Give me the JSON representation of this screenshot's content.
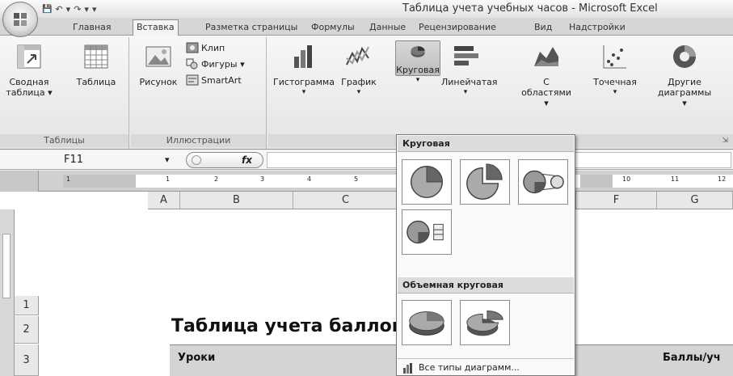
{
  "window": {
    "title": "Таблица учета учебных часов - Microsoft Excel"
  },
  "quick_access": {
    "save": "💾",
    "undo": "↶",
    "redo": "↷",
    "more": "▾"
  },
  "tabs": [
    "Главная",
    "Вставка",
    "Разметка страницы",
    "Формулы",
    "Данные",
    "Рецензирование",
    "Вид",
    "Надстройки"
  ],
  "ribbon": {
    "groups": {
      "tables": "Таблицы",
      "illustrations": "Иллюстрации",
      "charts_corner": "⇲"
    },
    "buttons": {
      "pivot": "Сводная таблица ▾",
      "table": "Таблица",
      "picture": "Рисунок",
      "clip": "Клип",
      "shapes": "Фигуры ▾",
      "smartart": "SmartArt",
      "histogram": "Гистограмма",
      "histogram_arrow": "▾",
      "graph": "График",
      "graph_arrow": "▾",
      "pie": "Круговая",
      "pie_arrow": "▾",
      "bar": "Линейчатая",
      "bar_arrow": "▾",
      "area": "С областями ▾",
      "scatter": "Точечная",
      "scatter_arrow": "▾",
      "other": "Другие диаграммы ▾"
    }
  },
  "formula_bar": {
    "cell": "F11",
    "dropdown": "▾",
    "fx": "fx",
    "value": ""
  },
  "sheet": {
    "columns": [
      "A",
      "B",
      "C",
      "",
      "F",
      "G"
    ],
    "rows": [
      "1",
      "2",
      "3"
    ],
    "title": "Таблица учета баллов и часов",
    "header_lessons": "Уроки",
    "header_points": "Баллы/уч"
  },
  "ruler_ticks": [
    "1",
    "1",
    "2",
    "3",
    "4",
    "5",
    "10",
    "11",
    "12"
  ],
  "dropdown": {
    "section_pie": "Круговая",
    "section_3d": "Объемная круговая",
    "all_types": "Все типы диаграмм...",
    "all_types_underline": "В"
  }
}
